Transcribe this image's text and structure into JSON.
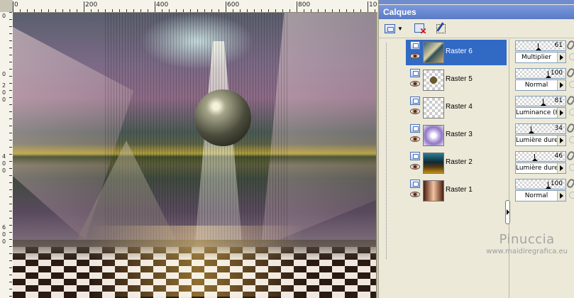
{
  "ruler": {
    "top_ticks": [
      "0",
      "200",
      "400",
      "600",
      "800",
      "10"
    ],
    "left_ticks": [
      "0",
      "0",
      "2",
      "0",
      "0",
      "4",
      "0",
      "0",
      "6",
      "0",
      "0"
    ]
  },
  "panel": {
    "title": "Calques",
    "toolbar": {
      "new_layer": "new-raster-layer-icon",
      "delete_layer": "delete-layer-icon",
      "edit_selection": "edit-selection-icon"
    }
  },
  "layers": [
    {
      "name": "Raster 6",
      "opacity": "61",
      "opacity_fraction": 0.61,
      "blend": "Multiplier",
      "selected": true
    },
    {
      "name": "Raster 5",
      "opacity": "100",
      "opacity_fraction": 1.0,
      "blend": "Normal",
      "selected": false
    },
    {
      "name": "Raster 4",
      "opacity": "81",
      "opacity_fraction": 0.81,
      "blend": "Luminance (H)",
      "selected": false
    },
    {
      "name": "Raster 3",
      "opacity": "34",
      "opacity_fraction": 0.34,
      "blend": "Lumière dure",
      "selected": false
    },
    {
      "name": "Raster 2",
      "opacity": "46",
      "opacity_fraction": 0.46,
      "blend": "Lumière dure",
      "selected": false
    },
    {
      "name": "Raster 1",
      "opacity": "100",
      "opacity_fraction": 1.0,
      "blend": "Normal",
      "selected": false
    }
  ],
  "watermark": {
    "title": "Pinuccia",
    "url": "www.maidiregrafica.eu"
  },
  "colors": {
    "selection": "#316ac5",
    "titlebar": "#5a7ac6",
    "panel_bg": "#ece9d8"
  }
}
